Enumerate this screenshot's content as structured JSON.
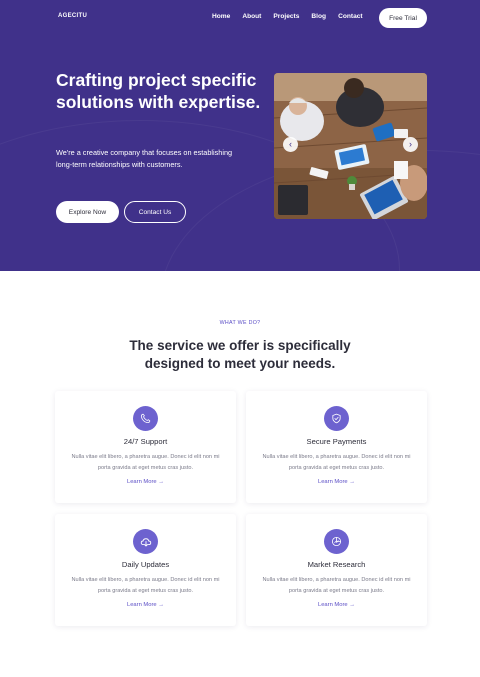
{
  "header": {
    "logo": "AGECITU",
    "nav": [
      "Home",
      "About",
      "Projects",
      "Blog",
      "Contact"
    ],
    "cta": "Free Trial"
  },
  "hero": {
    "title": "Crafting project specific solutions with expertise.",
    "text": "We're a creative company that focuses on establishing long-term relationships with customers.",
    "primary_button": "Explore Now",
    "secondary_button": "Contact Us",
    "slider_prev_icon": "chevron-left-icon",
    "slider_next_icon": "chevron-right-icon"
  },
  "services": {
    "eyebrow": "WHAT WE DO?",
    "title_line1": "The service we offer is specifically",
    "title_line2": "designed to meet your needs.",
    "cards": [
      {
        "icon": "phone-icon",
        "title": "24/7 Support",
        "text": "Nulla vitae elit libero, a pharetra augue. Donec id elit non mi porta gravida at eget metus cras justo.",
        "link": "Learn More →"
      },
      {
        "icon": "shield-icon",
        "title": "Secure Payments",
        "text": "Nulla vitae elit libero, a pharetra augue. Donec id elit non mi porta gravida at eget metus cras justo.",
        "link": "Learn More →"
      },
      {
        "icon": "cloud-download-icon",
        "title": "Daily Updates",
        "text": "Nulla vitae elit libero, a pharetra augue. Donec id elit non mi porta gravida at eget metus cras justo.",
        "link": "Learn More →"
      },
      {
        "icon": "chart-icon",
        "title": "Market Research",
        "text": "Nulla vitae elit libero, a pharetra augue. Donec id elit non mi porta gravida at eget metus cras justo.",
        "link": "Learn More →"
      }
    ]
  },
  "colors": {
    "brand": "#40318a",
    "accent": "#6d62cf",
    "link": "#5b4ec6"
  }
}
